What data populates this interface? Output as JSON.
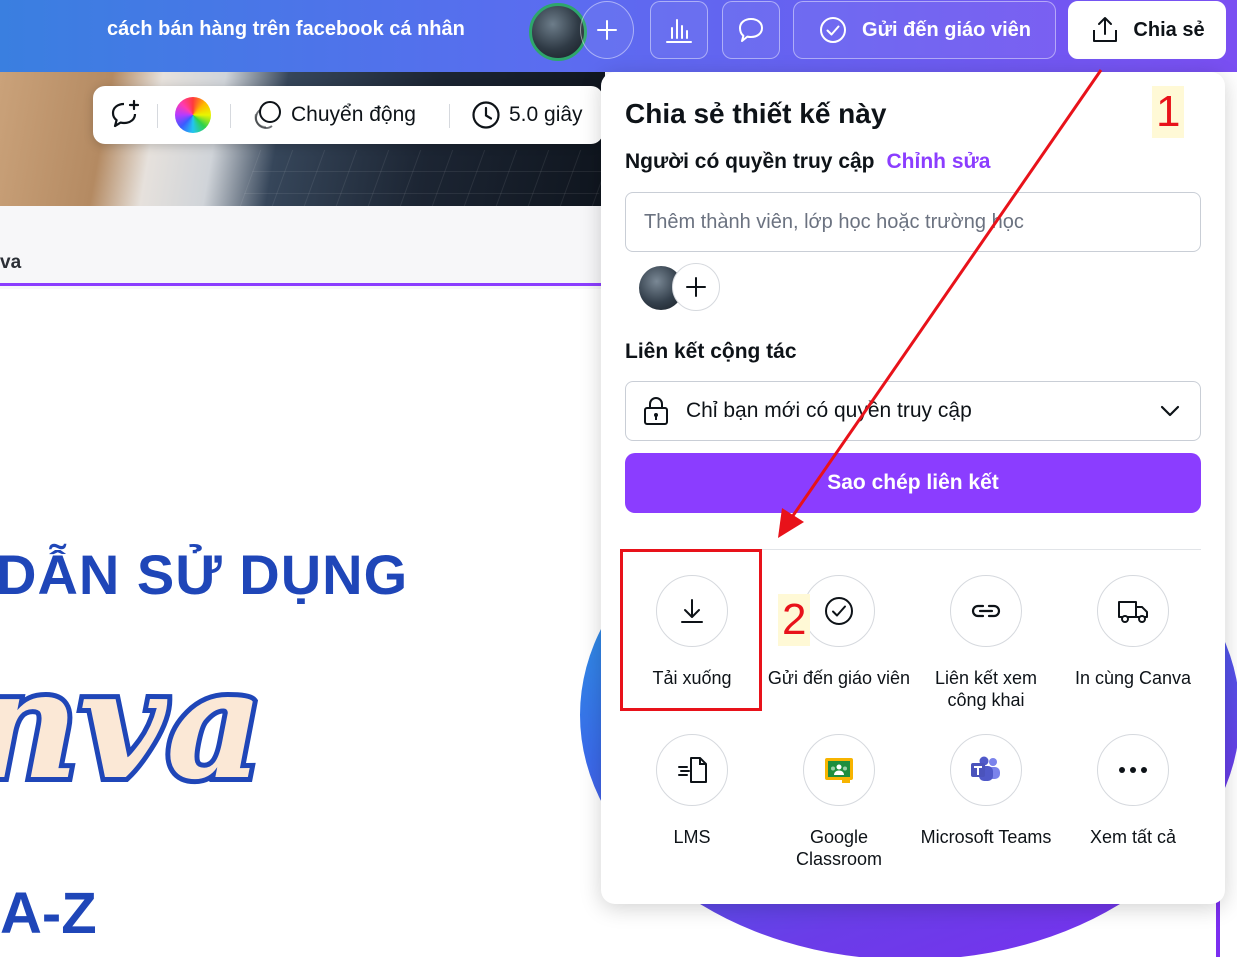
{
  "topbar": {
    "doc_title": "cách bán hàng trên facebook cá nhân",
    "send_to_teacher": "Gửi đến giáo viên",
    "share": "Chia sẻ"
  },
  "canvas_toolbar": {
    "motion": "Chuyển động",
    "duration": "5.0 giây"
  },
  "canvas": {
    "page_label": "va",
    "heading": "DẪN SỬ DỤNG",
    "brand": "nva",
    "subtitle": "A-Z"
  },
  "share_panel": {
    "title": "Chia sẻ thiết kế này",
    "access_label": "Người có quyền truy cập",
    "edit_link": "Chỉnh sửa",
    "member_placeholder": "Thêm thành viên, lớp học hoặc trường học",
    "collab_label": "Liên kết cộng tác",
    "access_option": "Chỉ bạn mới có quyền truy cập",
    "copy_link": "Sao chép liên kết",
    "options": [
      {
        "label": "Tải xuống",
        "icon": "download-icon"
      },
      {
        "label": "Gửi đến giáo viên",
        "icon": "check-circle-icon"
      },
      {
        "label": "Liên kết xem công khai",
        "icon": "link-icon"
      },
      {
        "label": "In cùng Canva",
        "icon": "truck-icon"
      },
      {
        "label": "LMS",
        "icon": "lms-icon"
      },
      {
        "label": "Google Classroom",
        "icon": "google-classroom-icon"
      },
      {
        "label": "Microsoft Teams",
        "icon": "microsoft-teams-icon"
      },
      {
        "label": "Xem tất cả",
        "icon": "more-icon"
      }
    ]
  },
  "annotations": {
    "step1": "1",
    "step2": "2",
    "color": "#e8121a"
  },
  "colors": {
    "accent": "#8b3dff",
    "heading_blue": "#1f46b8"
  }
}
